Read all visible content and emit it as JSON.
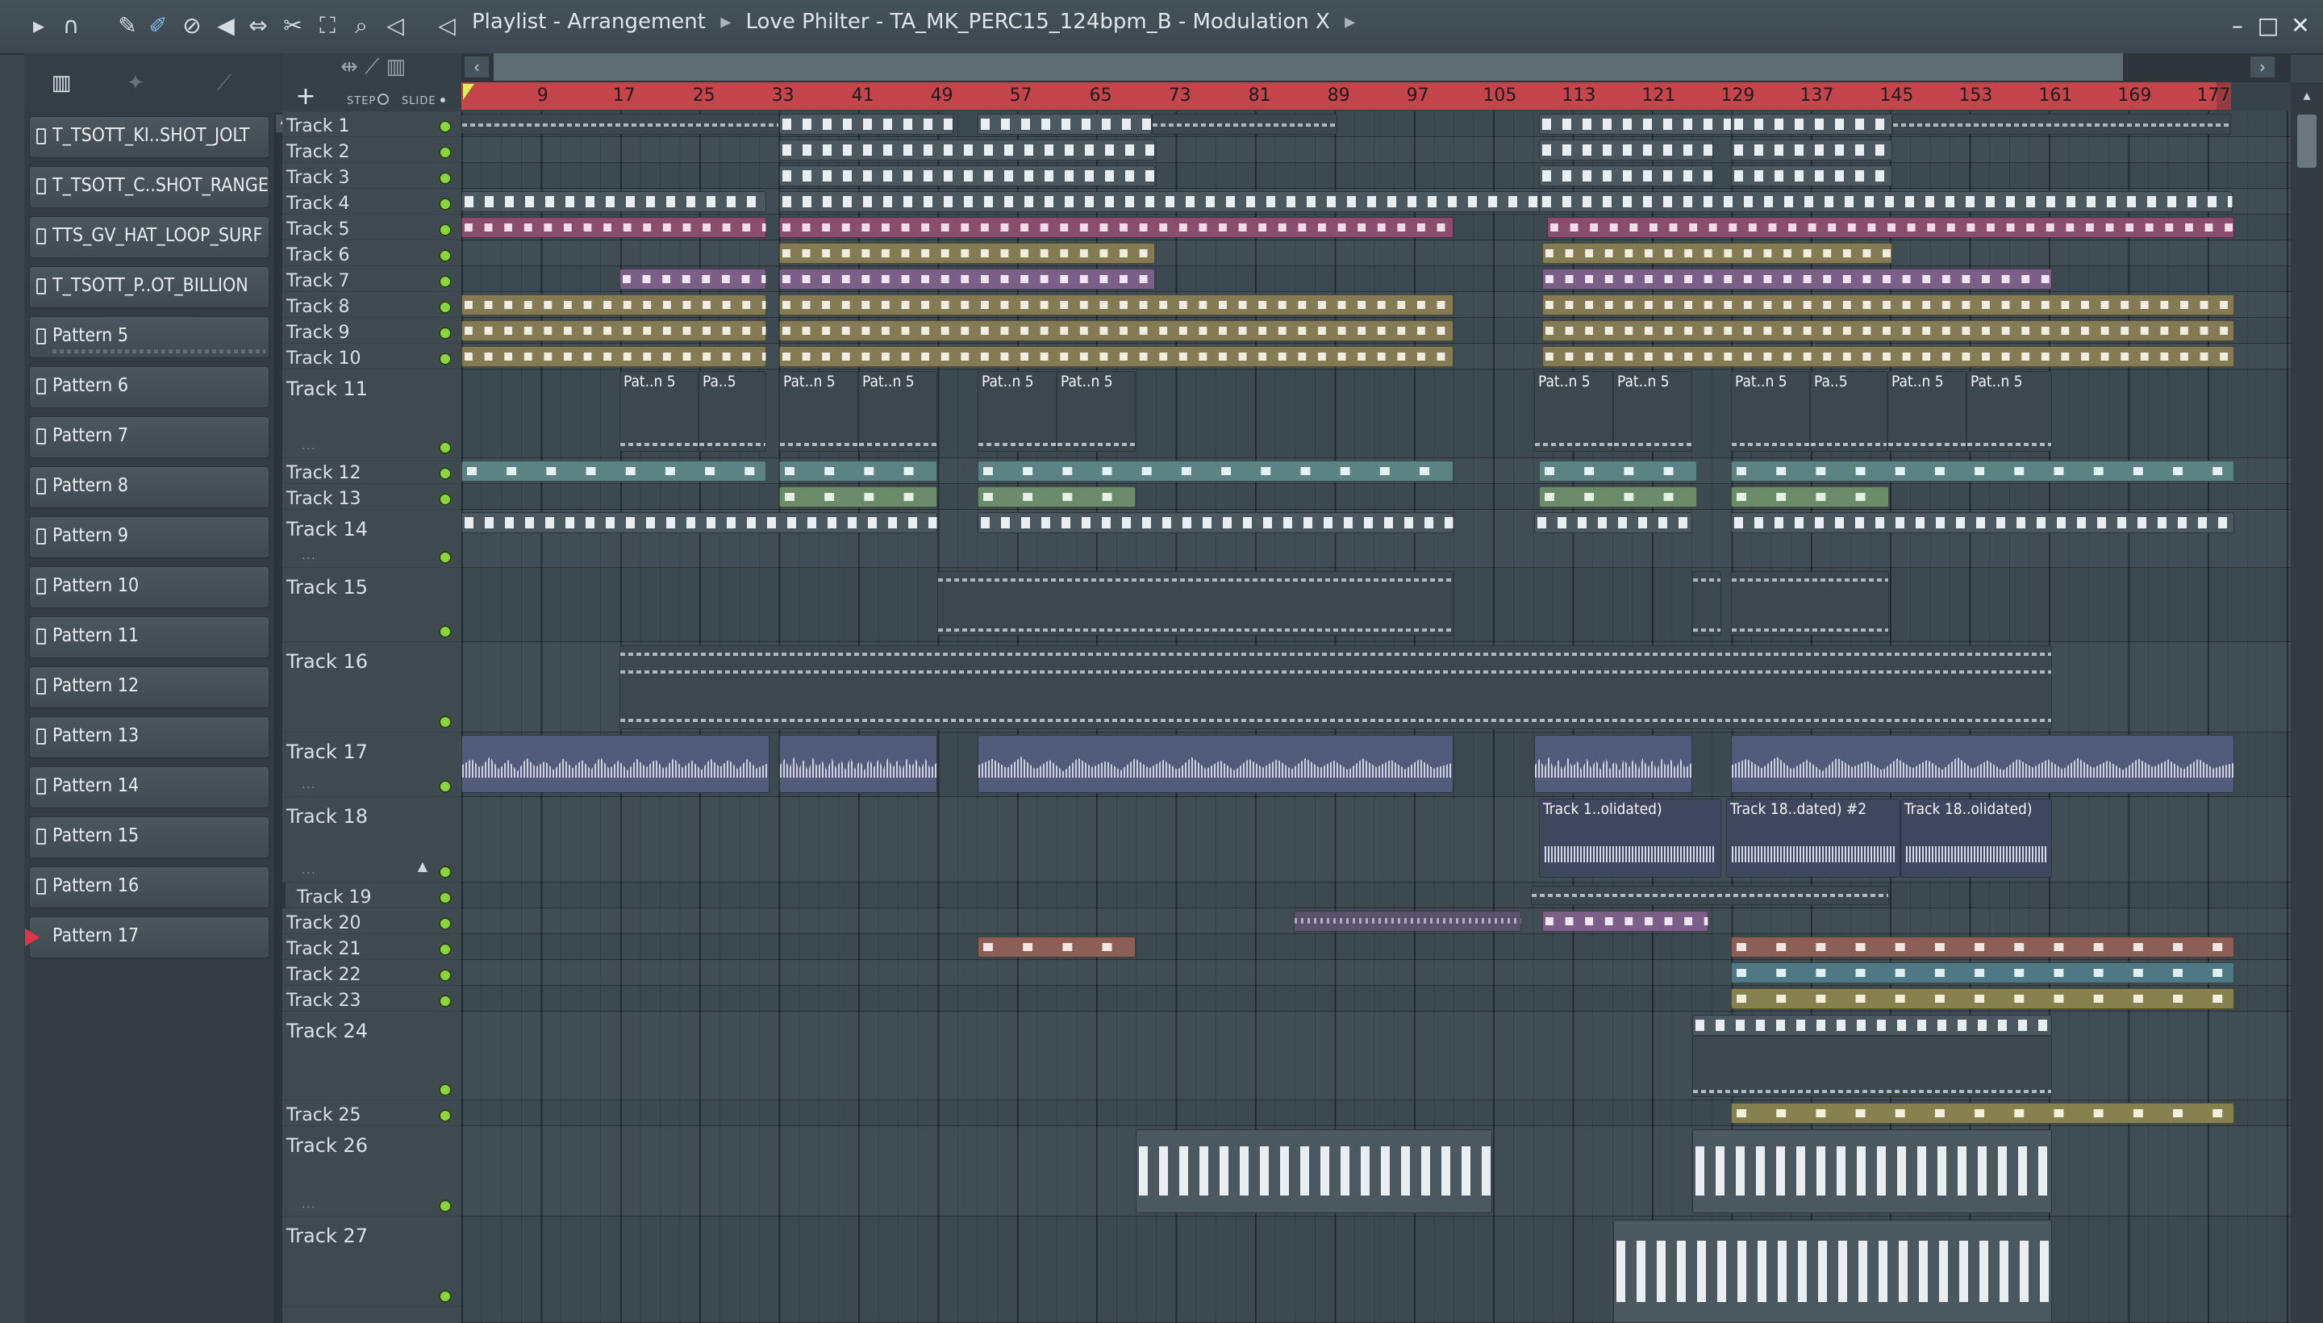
{
  "window": {
    "title_parts": [
      "Playlist - Arrangement",
      "Love Philter - TA_MK_PERC15_124bpm_B - Modulation X"
    ],
    "controls": [
      "minimize",
      "maximize",
      "close"
    ]
  },
  "toolbar": {
    "icons": [
      "play-icon",
      "magnet-icon",
      "pencil-icon",
      "paint-icon",
      "delete-icon",
      "mute-icon",
      "slip-icon",
      "slice-icon",
      "select-icon",
      "zoom-icon",
      "playback-icon",
      "speaker-icon"
    ]
  },
  "browser": {
    "patterns": [
      {
        "name": "T_TSOTT_KI..SHOT_JOLT"
      },
      {
        "name": "T_TSOTT_C..SHOT_RANGE"
      },
      {
        "name": "TTS_GV_HAT_LOOP_SURF"
      },
      {
        "name": "T_TSOTT_P..OT_BILLION"
      },
      {
        "name": "Pattern 5"
      },
      {
        "name": "Pattern 6"
      },
      {
        "name": "Pattern 7"
      },
      {
        "name": "Pattern 8"
      },
      {
        "name": "Pattern 9"
      },
      {
        "name": "Pattern 10"
      },
      {
        "name": "Pattern 11"
      },
      {
        "name": "Pattern 12"
      },
      {
        "name": "Pattern 13"
      },
      {
        "name": "Pattern 14"
      },
      {
        "name": "Pattern 15"
      },
      {
        "name": "Pattern 16"
      },
      {
        "name": "Pattern 17",
        "current": true
      }
    ]
  },
  "header": {
    "add_label": "+",
    "step_label": "STEP",
    "slide_label": "SLIDE"
  },
  "ruler": {
    "bar_numbers": [
      "9",
      "17",
      "25",
      "33",
      "41",
      "49",
      "57",
      "65",
      "73",
      "81",
      "89",
      "97",
      "105",
      "113",
      "121",
      "129",
      "137",
      "145",
      "153",
      "161",
      "169",
      "177"
    ]
  },
  "tracks": [
    {
      "name": "Track 1"
    },
    {
      "name": "Track 2"
    },
    {
      "name": "Track 3"
    },
    {
      "name": "Track 4"
    },
    {
      "name": "Track 5"
    },
    {
      "name": "Track 6"
    },
    {
      "name": "Track 7"
    },
    {
      "name": "Track 8"
    },
    {
      "name": "Track 9"
    },
    {
      "name": "Track 10"
    },
    {
      "name": "Track 11"
    },
    {
      "name": "Track 12"
    },
    {
      "name": "Track 13"
    },
    {
      "name": "Track 14"
    },
    {
      "name": "Track 15"
    },
    {
      "name": "Track 16"
    },
    {
      "name": "Track 17"
    },
    {
      "name": "Track 18"
    },
    {
      "name": "Track 19"
    },
    {
      "name": "Track 20"
    },
    {
      "name": "Track 21"
    },
    {
      "name": "Track 22"
    },
    {
      "name": "Track 23"
    },
    {
      "name": "Track 24"
    },
    {
      "name": "Track 25"
    },
    {
      "name": "Track 26"
    },
    {
      "name": "Track 27"
    }
  ],
  "clip_labels": {
    "t11": [
      "Pat..n 5",
      "Pa..5",
      "Pat..n 5",
      "Pat..n 5",
      "Pat..n 5",
      "Pat..n 5",
      "Pat..n 5",
      "Pat..n 5",
      "Pat..n 5",
      "Pa..5",
      "Pat..n 5",
      "Pat..n 5"
    ],
    "t18": [
      "Track 1..olidated)",
      "Track 18..dated) #2",
      "Track 18..olidated)"
    ]
  },
  "colors": {
    "accent_ruler": "#c5454d",
    "mute_led": "#8bd63b",
    "current_pattern_marker": "#e0344a"
  }
}
